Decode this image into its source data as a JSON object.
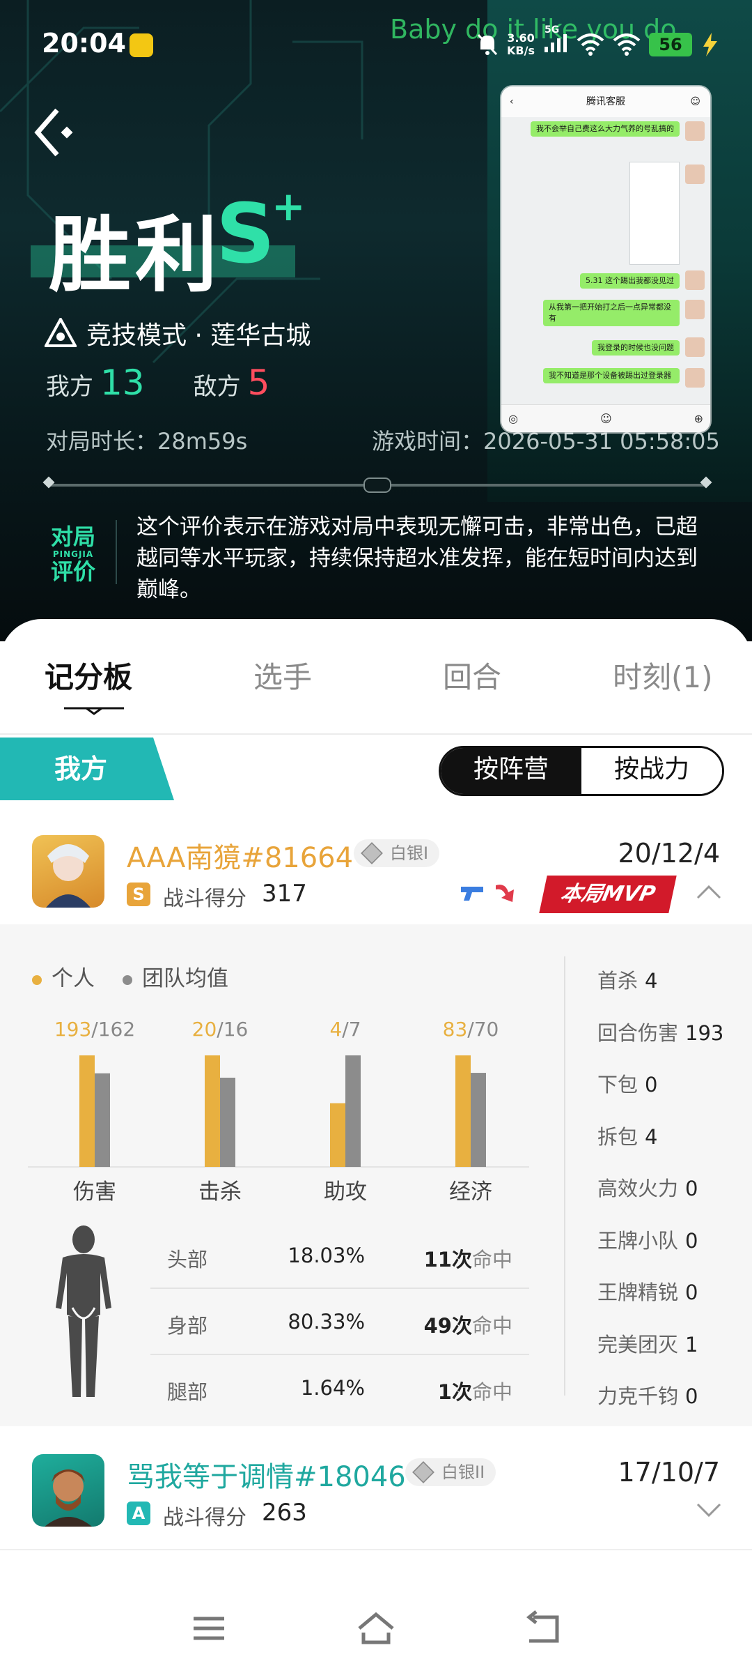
{
  "status": {
    "time": "20:04",
    "song": "Baby do it like you do",
    "net_speed_top": "3.60",
    "net_speed_bottom": "KB/s",
    "net_type": "5G",
    "battery": "56"
  },
  "header": {
    "result": "胜利",
    "grade": "S",
    "grade_plus": "+",
    "mode": "竞技模式 · 莲华古城",
    "ours_label": "我方",
    "ours_score": "13",
    "theirs_label": "敌方",
    "theirs_score": "5",
    "duration": "对局时长：28m59s",
    "game_time": "游戏时间：2026-05-31 05:58:05",
    "eval_tag_line1": "对局",
    "eval_tag_pinyin": "PINGJIA",
    "eval_tag_line2": "评价",
    "eval_text": "这个评价表示在游戏对局中表现无懈可击，非常出色，已超越同等水平玩家，持续保持超水准发挥，能在短时间内达到巅峰。"
  },
  "chat_overlay": {
    "title": "腾讯客服",
    "messages": [
      "我不会举自己费这么大力气养的号乱搞的",
      "5.31 这个踢出我都没见过",
      "从我第一把开始打之后一点异常都没有",
      "我登录的时候也没问题",
      "我不知道是那个设备被踢出过登录器"
    ]
  },
  "tabs": [
    "记分板",
    "选手",
    "回合",
    "时刻(1)"
  ],
  "team_banner": "我方",
  "sort_toggle": {
    "by_camp": "按阵营",
    "by_power": "按战力"
  },
  "players": [
    {
      "name": "AAA南獍#81664",
      "rank": "白银I",
      "grade": "S",
      "score_label": "战斗得分",
      "score": "317",
      "kda": "20/12/4",
      "mvp": "本局MVP",
      "name_color": "#e8a43a",
      "grade_color": "#e8a43a"
    },
    {
      "name": "骂我等于调情#18046",
      "rank": "白银II",
      "grade": "A",
      "score_label": "战斗得分",
      "score": "263",
      "kda": "17/10/7",
      "name_color": "#1fa89f",
      "grade_color": "#22b8b4"
    }
  ],
  "detail": {
    "legend_personal": "个人",
    "legend_team": "团队均值",
    "colors": {
      "personal": "#e8b040",
      "team": "#8c8c8c"
    },
    "hit_parts": [
      {
        "part": "头部",
        "pct": "18.03%",
        "count": "11次",
        "suffix": "命中"
      },
      {
        "part": "身部",
        "pct": "80.33%",
        "count": "49次",
        "suffix": "命中"
      },
      {
        "part": "腿部",
        "pct": "1.64%",
        "count": "1次",
        "suffix": "命中"
      }
    ],
    "stats": [
      {
        "label": "首杀",
        "value": "4"
      },
      {
        "label": "回合伤害",
        "value": "193"
      },
      {
        "label": "下包",
        "value": "0"
      },
      {
        "label": "拆包",
        "value": "4"
      },
      {
        "label": "高效火力",
        "value": "0"
      },
      {
        "label": "王牌小队",
        "value": "0"
      },
      {
        "label": "王牌精锐",
        "value": "0"
      },
      {
        "label": "完美团灭",
        "value": "1"
      },
      {
        "label": "力克千钧",
        "value": "0"
      }
    ]
  },
  "chart_data": {
    "type": "bar",
    "categories": [
      "伤害",
      "击杀",
      "助攻",
      "经济"
    ],
    "series": [
      {
        "name": "个人",
        "values": [
          193,
          20,
          4,
          83
        ]
      },
      {
        "name": "团队均值",
        "values": [
          162,
          16,
          7,
          70
        ]
      }
    ],
    "labels_personal": [
      "193",
      "20",
      "4",
      "83"
    ],
    "labels_team": [
      "/162",
      "/16",
      "/7",
      "/70"
    ]
  }
}
